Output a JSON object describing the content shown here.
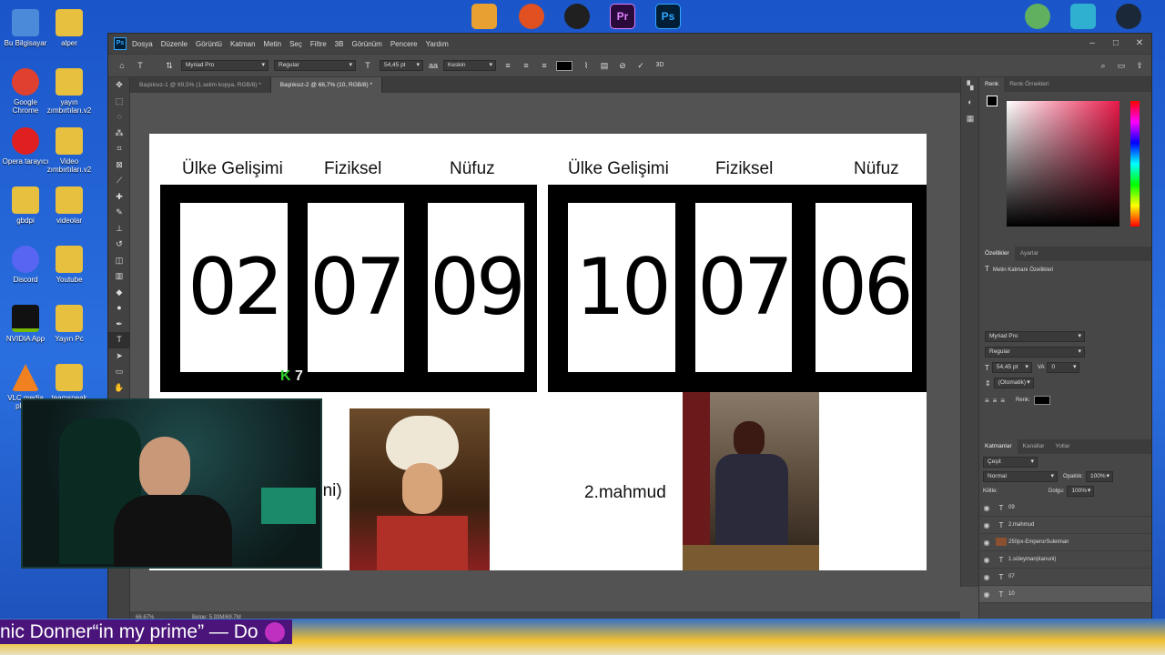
{
  "desktop": {
    "icons": [
      {
        "label": "Bu Bilgisayar",
        "color": "#4a8ad8"
      },
      {
        "label": "alper",
        "color": "#e8c040"
      },
      {
        "label": "Google Chrome",
        "color": "#e04030"
      },
      {
        "label": "yayın zımbırtıları.v2",
        "color": "#e8c040"
      },
      {
        "label": "Opera tarayıcı",
        "color": "#e02020"
      },
      {
        "label": "Video zımbırtıları.v2",
        "color": "#e8c040"
      },
      {
        "label": "gbdpi",
        "color": "#e8c040"
      },
      {
        "label": "videolar",
        "color": "#e8c040"
      },
      {
        "label": "Discord",
        "color": "#5865f2"
      },
      {
        "label": "Youtube",
        "color": "#e8c040"
      },
      {
        "label": "NVIDIA App",
        "color": "#76b900"
      },
      {
        "label": "Yayın Pc",
        "color": "#e8c040"
      },
      {
        "label": "VLC media player",
        "color": "#f08020"
      },
      {
        "label": "teamspeak",
        "color": "#e8c040"
      }
    ],
    "top_icons": [
      "pineapple-icon",
      "firefox-icon",
      "obs-icon",
      "premiere-icon",
      "photoshop-icon",
      "vpn-icon",
      "triangle-icon",
      "steam-icon"
    ]
  },
  "window": {
    "menu": [
      "Dosya",
      "Düzenle",
      "Görüntü",
      "Katman",
      "Metin",
      "Seç",
      "Filtre",
      "3B",
      "Görünüm",
      "Pencere",
      "Yardım"
    ],
    "options": {
      "font_family": "Myriad Pro",
      "font_style": "Regular",
      "font_size": "54,45 pt",
      "antialias_label": "aa",
      "antialias": "Keskin"
    },
    "tabs": [
      "Başlıksız-1 @ 69,5% (1.selim kopya, RGB/8) *",
      "Başlıksız-2 @ 66,7% (10, RGB/8) *"
    ],
    "status": {
      "zoom": "66,67%",
      "doc": "Belge: 5,93M/69,7M"
    }
  },
  "canvas": {
    "left_group": {
      "headers": [
        "Ülke Gelişimi",
        "Fiziksel",
        "Nüfuz"
      ],
      "values": [
        "02",
        "07",
        "09"
      ]
    },
    "right_group": {
      "headers": [
        "Ülke Gelişimi",
        "Fiziksel",
        "Nüfuz"
      ],
      "values": [
        "10",
        "07",
        "06"
      ]
    },
    "left_caption": "uni)",
    "right_caption": "2.mahmud",
    "overlay_badge": "7"
  },
  "panels": {
    "color": {
      "tabs": [
        "Renk",
        "Renk Örnekleri"
      ]
    },
    "properties": {
      "tabs": [
        "Özellikler",
        "Ayarlar"
      ],
      "title": "Metin Katmanı Özellikleri",
      "font_family": "Myriad Pro",
      "font_style": "Regular",
      "size": "54,45 pt",
      "tracking_label": "VA",
      "tracking": "0",
      "leading": "(Otomatik)",
      "color_label": "Renk:"
    },
    "layers": {
      "tabs": [
        "Katmanlar",
        "Kanallar",
        "Yollar"
      ],
      "search": "Çeşit",
      "blend": "Normal",
      "opacity_label": "Opaklık:",
      "opacity": "100%",
      "lock_label": "Kilitle:",
      "fill_label": "Dolgu:",
      "fill": "100%",
      "items": [
        {
          "type": "T",
          "name": "09"
        },
        {
          "type": "T",
          "name": "2.mahmud"
        },
        {
          "type": "img",
          "name": "250px-EmperorSuleiman"
        },
        {
          "type": "T",
          "name": "1.süleyman(kanuni)"
        },
        {
          "type": "T",
          "name": "07"
        },
        {
          "type": "T",
          "name": "10"
        }
      ]
    }
  },
  "ticker": {
    "text": "nic Donner“in my prime” — Do"
  }
}
